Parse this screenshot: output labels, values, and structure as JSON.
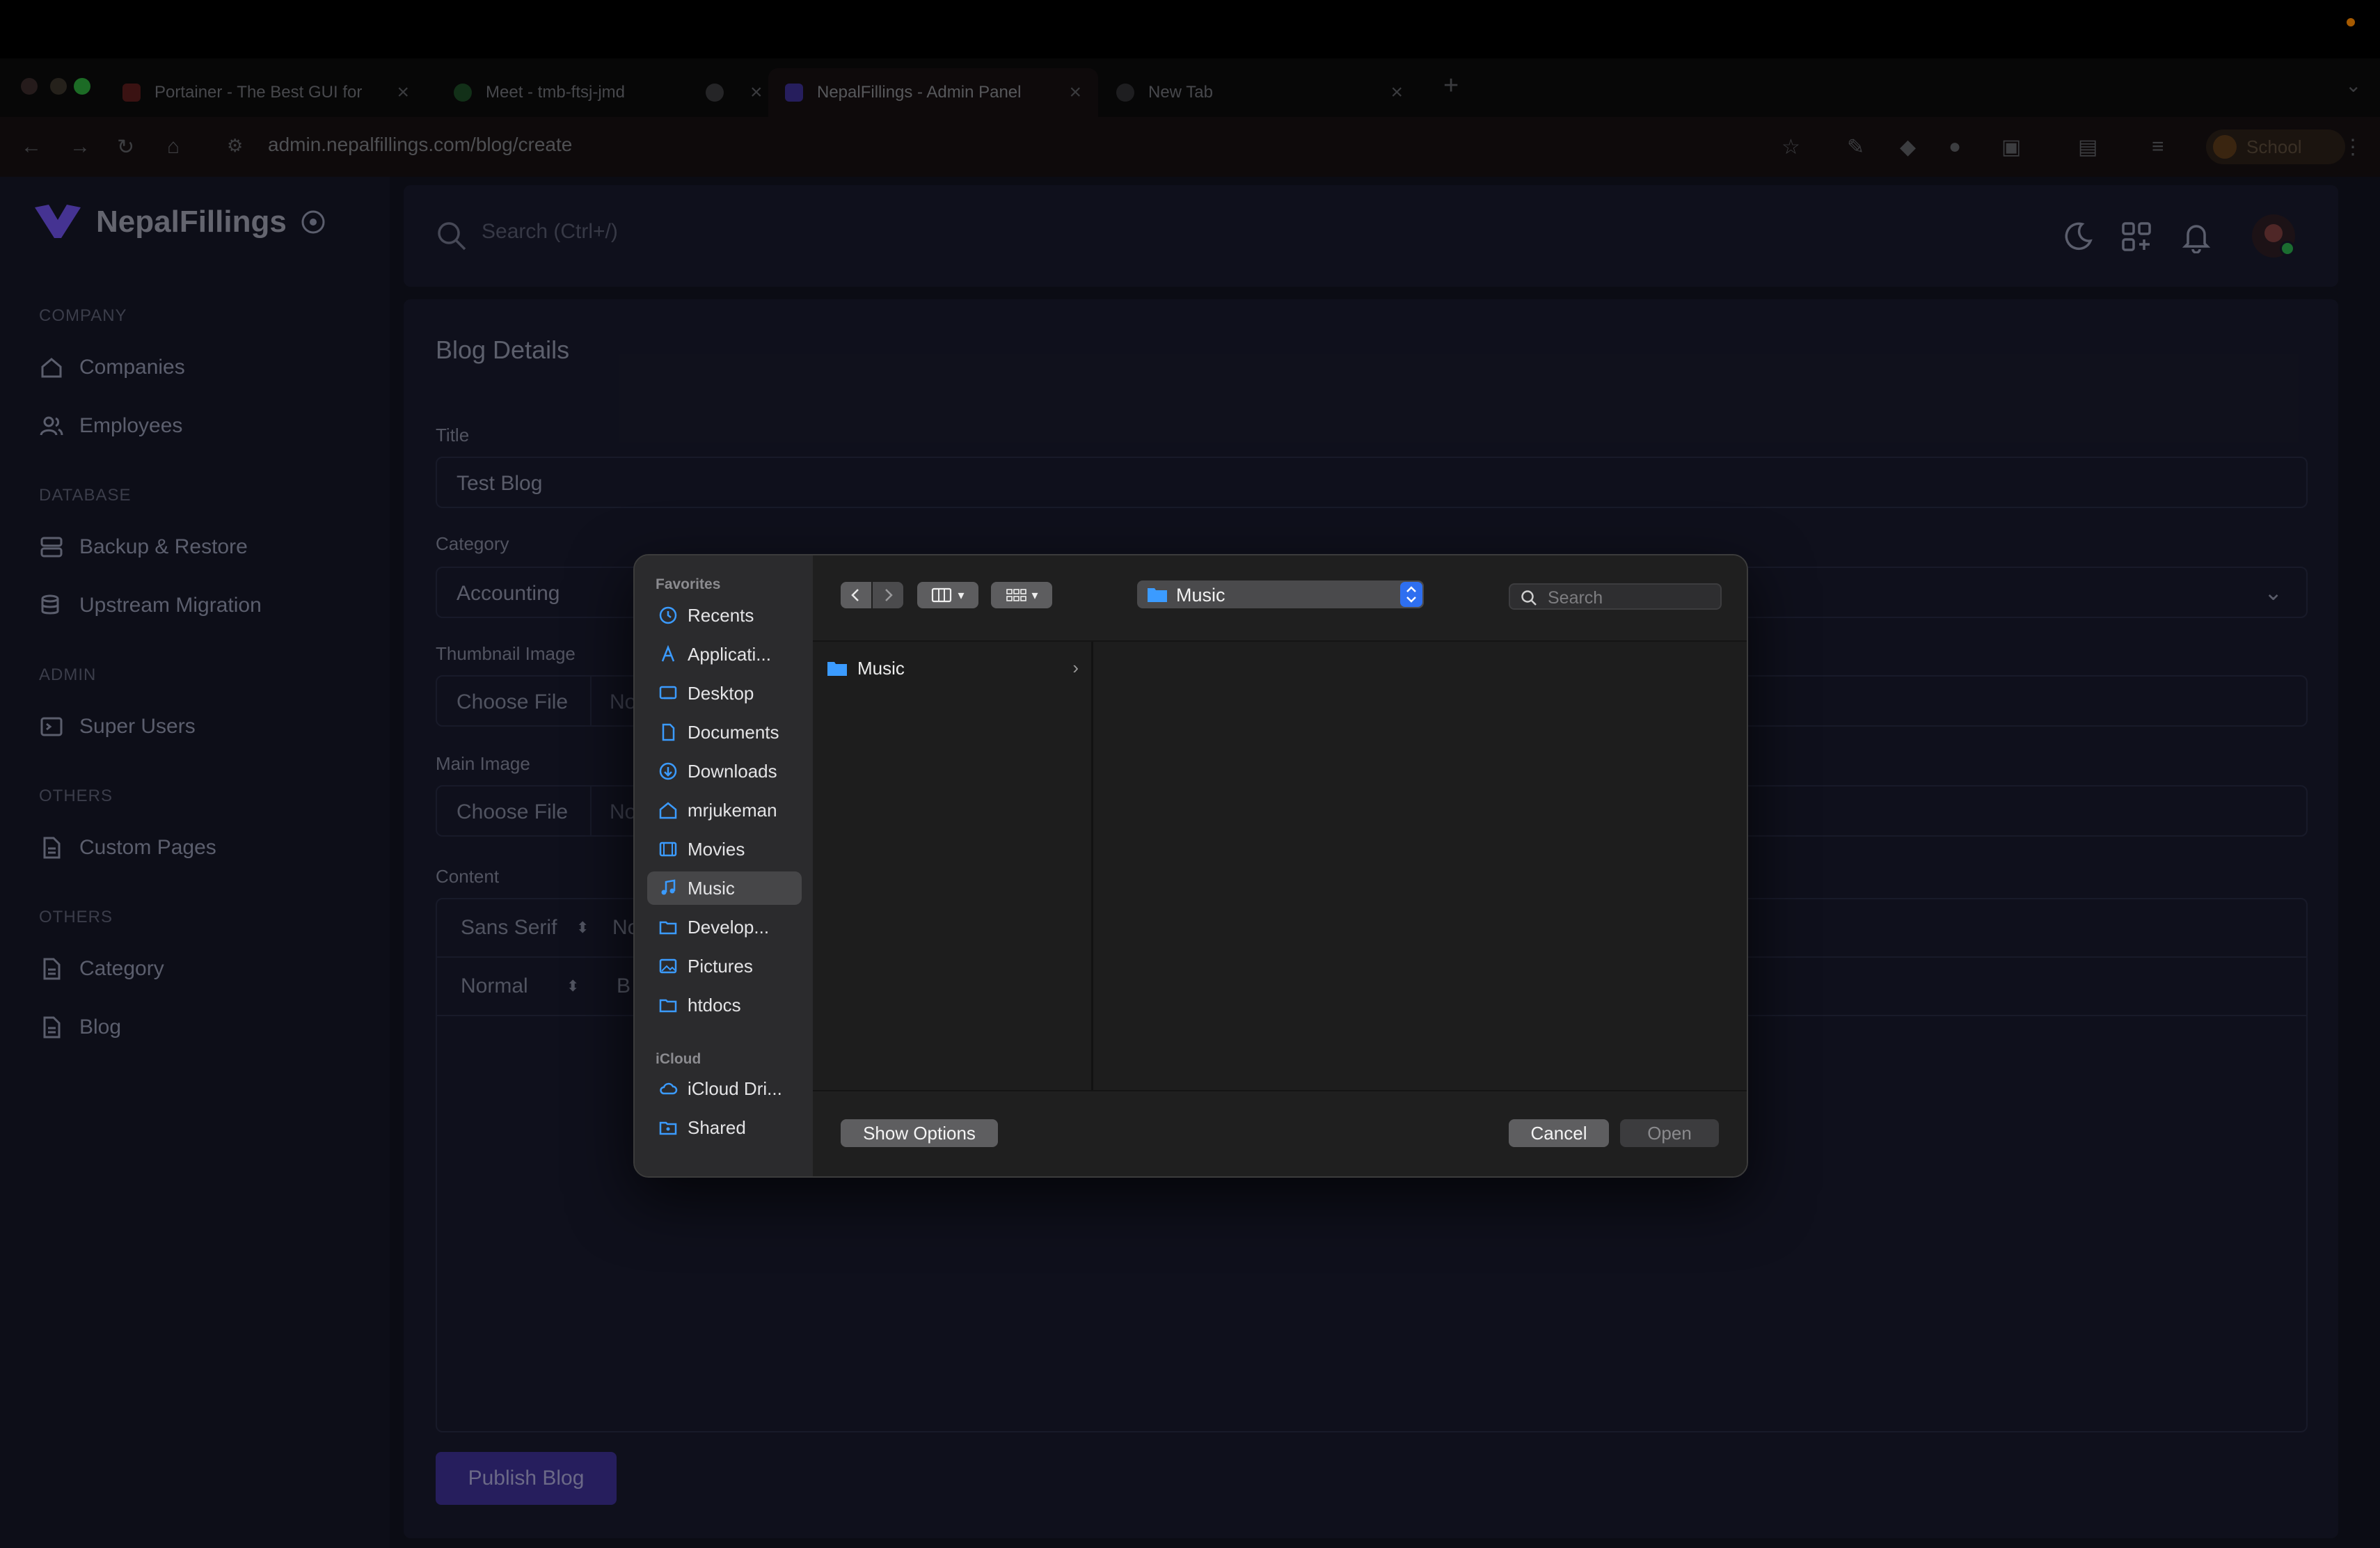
{
  "browser": {
    "tabs": [
      {
        "title": "Portainer - The Best GUI for",
        "favicon_color": "#c9302c"
      },
      {
        "title": "Meet - tmb-ftsj-jmd",
        "favicon_color": "#2f9e44"
      },
      {
        "title": "",
        "favicon_color": "#7a7b80"
      },
      {
        "title": "NepalFillings - Admin Panel",
        "favicon_color": "#6c4cf5"
      },
      {
        "title": "New Tab",
        "favicon_color": "#7a7b80"
      }
    ],
    "url": "admin.nepalfillings.com/blog/create",
    "profile": "School"
  },
  "brand": {
    "name": "NepalFillings",
    "accent": "#7c5cff"
  },
  "sidebar": {
    "sections": [
      {
        "heading": "COMPANY",
        "items": [
          "Companies",
          "Employees"
        ]
      },
      {
        "heading": "DATABASE",
        "items": [
          "Backup & Restore",
          "Upstream Migration"
        ]
      },
      {
        "heading": "ADMIN",
        "items": [
          "Super Users"
        ]
      },
      {
        "heading": "OTHERS",
        "items": [
          "Custom Pages"
        ]
      },
      {
        "heading": "OTHERS",
        "items": [
          "Category",
          "Blog"
        ]
      }
    ]
  },
  "topbar": {
    "search_placeholder": "Search (Ctrl+/)"
  },
  "form": {
    "card_title": "Blog Details",
    "title_label": "Title",
    "title_value": "Test Blog",
    "category_label": "Category",
    "category_value": "Accounting",
    "thumbnail_label": "Thumbnail Image",
    "main_image_label": "Main Image",
    "choose_file": "Choose File",
    "no_file_cut": "No",
    "content_label": "Content",
    "font_select": "Sans Serif",
    "size_cut": "No",
    "heading_select": "Normal",
    "bold_cut": "B",
    "publish_label": "Publish Blog"
  },
  "dialog": {
    "favorites_heading": "Favorites",
    "favorites": [
      "Recents",
      "Applicati...",
      "Desktop",
      "Documents",
      "Downloads",
      "mrjukeman",
      "Movies",
      "Music",
      "Develop...",
      "Pictures",
      "htdocs"
    ],
    "selected": "Music",
    "icloud_heading": "iCloud",
    "icloud": [
      "iCloud Dri...",
      "Shared"
    ],
    "location": "Music",
    "search_placeholder": "Search",
    "column_items": [
      "Music"
    ],
    "show_options": "Show Options",
    "cancel": "Cancel",
    "open": "Open",
    "icon_color": "#3b9bff"
  }
}
